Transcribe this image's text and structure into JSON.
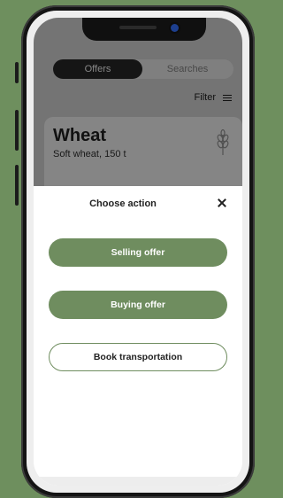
{
  "colors": {
    "background": "#6e8f5e",
    "accent": "#6f8d5f"
  },
  "tabs": [
    {
      "label": "Offers",
      "active": true
    },
    {
      "label": "Searches",
      "active": false
    }
  ],
  "filter": {
    "label": "Filter",
    "icon": "sliders-icon"
  },
  "card": {
    "title": "Wheat",
    "subtitle": "Soft wheat, 150 t",
    "icon": "wheat-icon"
  },
  "sheet": {
    "title": "Choose action",
    "close_icon": "close-icon",
    "actions": [
      {
        "label": "Selling offer",
        "style": "filled"
      },
      {
        "label": "Buying offer",
        "style": "filled"
      },
      {
        "label": "Book transportation",
        "style": "outlined"
      }
    ]
  }
}
